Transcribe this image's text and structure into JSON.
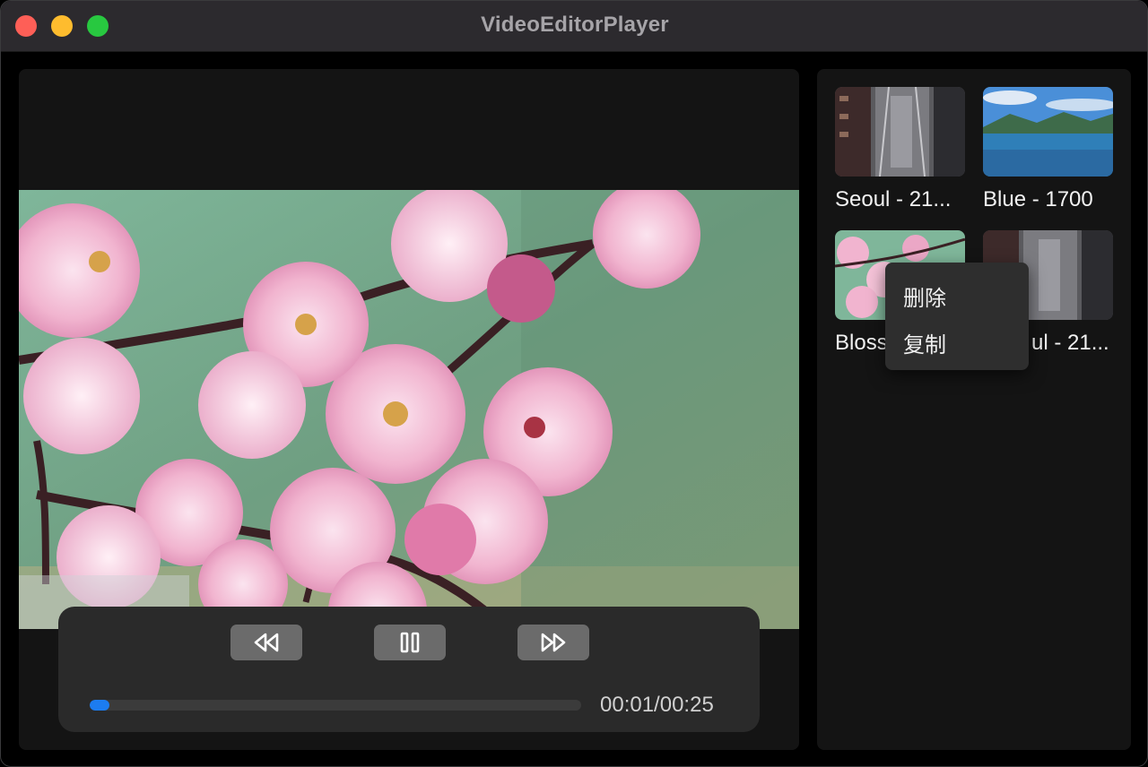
{
  "app": {
    "title": "VideoEditorPlayer"
  },
  "player": {
    "current_time": "00:01/00:25",
    "progress_fraction": 0.04,
    "buttons": [
      "rewind-icon",
      "pause-icon",
      "fast-forward-icon"
    ],
    "accent_color": "#1c7cf0"
  },
  "library": {
    "items": [
      {
        "label": "Seoul - 21..."
      },
      {
        "label": "Blue - 1700"
      },
      {
        "label": "Bloss"
      },
      {
        "label": "ul - 21..."
      }
    ]
  },
  "context_menu": {
    "items": [
      {
        "label": "删除"
      },
      {
        "label": "复制"
      }
    ]
  }
}
